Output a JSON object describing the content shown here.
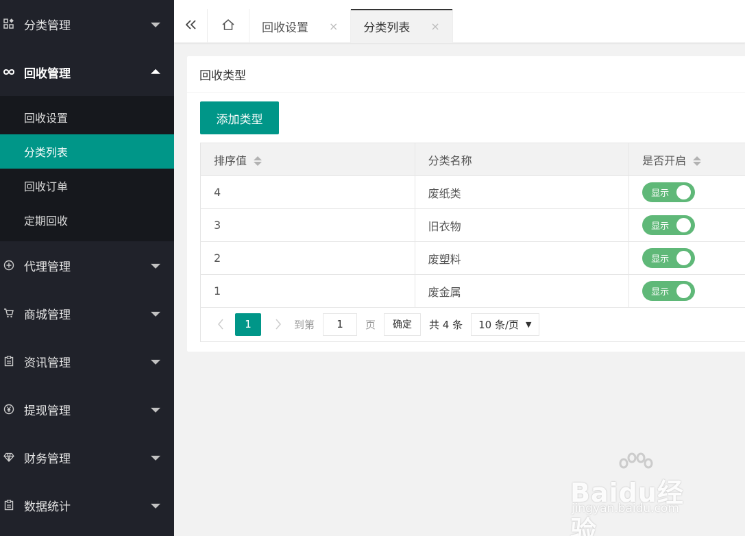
{
  "sidebar": {
    "items": [
      {
        "label": "分类管理",
        "icon": "grid-icon"
      },
      {
        "label": "回收管理",
        "icon": "infinity-icon",
        "open": true,
        "children": [
          "回收设置",
          "分类列表",
          "回收订单",
          "定期回收"
        ],
        "active_child": "分类列表"
      },
      {
        "label": "代理管理",
        "icon": "plus-circle-icon"
      },
      {
        "label": "商城管理",
        "icon": "cart-icon"
      },
      {
        "label": "资讯管理",
        "icon": "clipboard-icon"
      },
      {
        "label": "提现管理",
        "icon": "yen-icon"
      },
      {
        "label": "财务管理",
        "icon": "diamond-icon"
      },
      {
        "label": "数据统计",
        "icon": "clipboard-icon"
      }
    ]
  },
  "tabs": [
    {
      "label": "回收设置",
      "close": "×",
      "active": false
    },
    {
      "label": "分类列表",
      "close": "×",
      "active": true
    }
  ],
  "card": {
    "title": "回收类型",
    "add_button": "添加类型"
  },
  "table": {
    "headers": [
      "排序值",
      "分类名称",
      "是否开启"
    ],
    "rows": [
      {
        "sort": "4",
        "name": "废纸类",
        "status": "显示"
      },
      {
        "sort": "3",
        "name": "旧衣物",
        "status": "显示"
      },
      {
        "sort": "2",
        "name": "废塑料",
        "status": "显示"
      },
      {
        "sort": "1",
        "name": "废金属",
        "status": "显示"
      }
    ]
  },
  "pager": {
    "current": "1",
    "goto_label": "到第",
    "page_input": "1",
    "page_suffix": "页",
    "confirm": "确定",
    "total": "共 4 条",
    "page_size": "10 条/页"
  },
  "watermark": {
    "brand": "Baidu经验",
    "url": "jingyan.baidu.com"
  },
  "colors": {
    "sidebar_bg": "#20222a",
    "accent": "#009688",
    "switch_on": "#5fb878"
  }
}
